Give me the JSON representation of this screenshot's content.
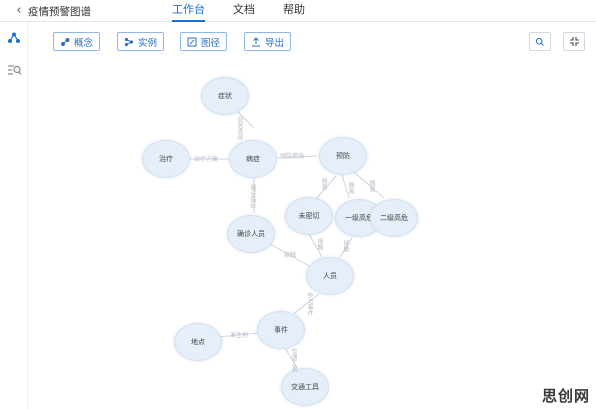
{
  "header": {
    "back_icon": "chevron-left-icon",
    "title": "疫情预警图谱",
    "tabs": [
      {
        "label": "工作台",
        "active": true
      },
      {
        "label": "文档",
        "active": false
      },
      {
        "label": "帮助",
        "active": false
      }
    ]
  },
  "sidebar": {
    "items": [
      {
        "icon": "graph-network-icon",
        "color": "#1a6fd6"
      },
      {
        "icon": "list-search-icon",
        "color": "#888888"
      }
    ]
  },
  "toolbar": {
    "buttons": [
      {
        "label": "概念",
        "icon": "concept-icon"
      },
      {
        "label": "实例",
        "icon": "instance-icon"
      },
      {
        "label": "图径",
        "icon": "path-icon"
      },
      {
        "label": "导出",
        "icon": "export-icon"
      }
    ],
    "right_buttons": [
      {
        "icon": "search-icon"
      },
      {
        "icon": "collapse-icon"
      }
    ]
  },
  "graph": {
    "nodes": {
      "zhengzhuang": "症状",
      "zhiliao": "治疗",
      "bingzheng": "病症",
      "yufang": "预防",
      "weiqueding": "未密切",
      "yiji": "一级高危",
      "erji": "二级高危",
      "quezhen": "确诊人员",
      "renyuan": "人员",
      "didian": "地点",
      "shijian": "事件",
      "jiaotong": "交通工具"
    },
    "edges": {
      "e1": "症状表现",
      "e2": "治疗方案",
      "e3": "预防措施",
      "e4": "确诊病症",
      "e5": "隔离",
      "e6": "隔离",
      "e7": "隔离",
      "e8": "接触",
      "e9": "接触",
      "e10": "接触",
      "e11": "参与事件",
      "e12": "发生地",
      "e13": "交通工具"
    },
    "accent_color": "#1a6fd6",
    "node_color": "#e6eef9"
  },
  "watermark": "思创网"
}
